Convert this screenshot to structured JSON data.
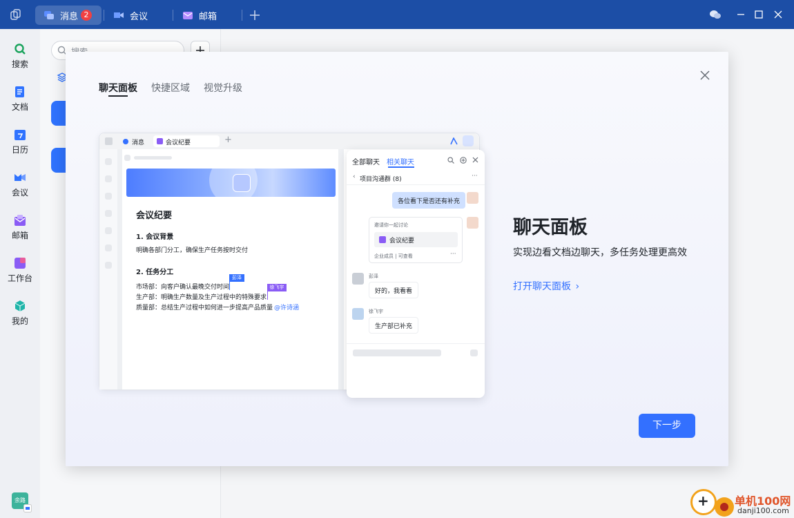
{
  "titlebar": {
    "tabs": [
      {
        "label": "消息",
        "badge": "2"
      },
      {
        "label": "会议"
      },
      {
        "label": "邮箱"
      }
    ]
  },
  "sidebar": {
    "items": [
      {
        "label": "搜索",
        "icon": "search-icon"
      },
      {
        "label": "文档",
        "icon": "doc-icon"
      },
      {
        "label": "日历",
        "icon": "calendar-icon"
      },
      {
        "label": "会议",
        "icon": "video-icon"
      },
      {
        "label": "邮箱",
        "icon": "mail-icon"
      },
      {
        "label": "工作台",
        "icon": "workbench-icon"
      },
      {
        "label": "我的",
        "icon": "cube-icon"
      }
    ],
    "avatar_label": "余路"
  },
  "listpane": {
    "search_placeholder": "搜索"
  },
  "modal": {
    "tabs": [
      "聊天面板",
      "快捷区域",
      "视觉升级"
    ],
    "heading": "聊天面板",
    "description": "实现边看文档边聊天，多任务处理更高效",
    "link": "打开聊天面板",
    "link_arrow": "›",
    "next_button": "下一步"
  },
  "preview": {
    "tab_messages": "消息",
    "tab_doc": "会议纪要",
    "doc": {
      "title": "会议纪要",
      "section1": "1. 会议背景",
      "section1_text": "明确各部门分工，确保生产任务按时交付",
      "section2": "2. 任务分工",
      "line1": "市场部：向客户确认最晚交付时间",
      "line2": "生产部：明确生产数量及生产过程中的特殊要求",
      "line3": "质量部：总结生产过程中如何进一步提高产品质量",
      "mention": "@许诗涵",
      "cursor1": "彭泽",
      "cursor2": "徐飞宇"
    },
    "chat": {
      "tab_all": "全部聊天",
      "tab_related": "相关聊天",
      "group": "项目沟通群 (8)",
      "msg1": "各位看下是否还有补充",
      "invite_title": "邀请你一起讨论",
      "invite_doc": "会议纪要",
      "invite_meta": "企业成员 | 可查看",
      "user1": "彭泽",
      "msg2": "好的，我看看",
      "user2": "徐飞宇",
      "msg3": "生产部已补充"
    }
  },
  "watermark": {
    "name": "单机100网",
    "url": "danji100.com"
  },
  "colors": {
    "titlebar": "#1c4ea6",
    "accent": "#3370ff",
    "badge": "#f04142"
  }
}
